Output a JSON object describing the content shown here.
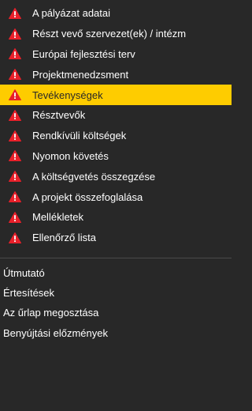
{
  "menu": {
    "items": [
      {
        "label": "A pályázat adatai",
        "icon": "warning-icon",
        "active": false
      },
      {
        "label": "Részt vevő szervezet(ek) / intézm",
        "icon": "warning-icon",
        "active": false
      },
      {
        "label": "Európai fejlesztési terv",
        "icon": "warning-icon",
        "active": false
      },
      {
        "label": "Projektmenedzsment",
        "icon": "warning-icon",
        "active": false
      },
      {
        "label": "Tevékenységek",
        "icon": "warning-icon",
        "active": true
      },
      {
        "label": "Résztvevők",
        "icon": "warning-icon",
        "active": false
      },
      {
        "label": "Rendkívüli költségek",
        "icon": "warning-icon",
        "active": false
      },
      {
        "label": "Nyomon követés",
        "icon": "warning-icon",
        "active": false
      },
      {
        "label": "A költségvetés összegzése",
        "icon": "warning-icon",
        "active": false
      },
      {
        "label": "A projekt összefoglalása",
        "icon": "warning-icon",
        "active": false
      },
      {
        "label": "Mellékletek",
        "icon": "warning-icon",
        "active": false
      },
      {
        "label": "Ellenőrző lista",
        "icon": "warning-icon",
        "active": false
      }
    ]
  },
  "links": [
    "Útmutató",
    "Értesítések",
    "Az űrlap megosztása",
    "Benyújtási előzmények"
  ],
  "colors": {
    "background": "#282828",
    "active_background": "#fecc00",
    "warning_icon": "#e8202a"
  }
}
